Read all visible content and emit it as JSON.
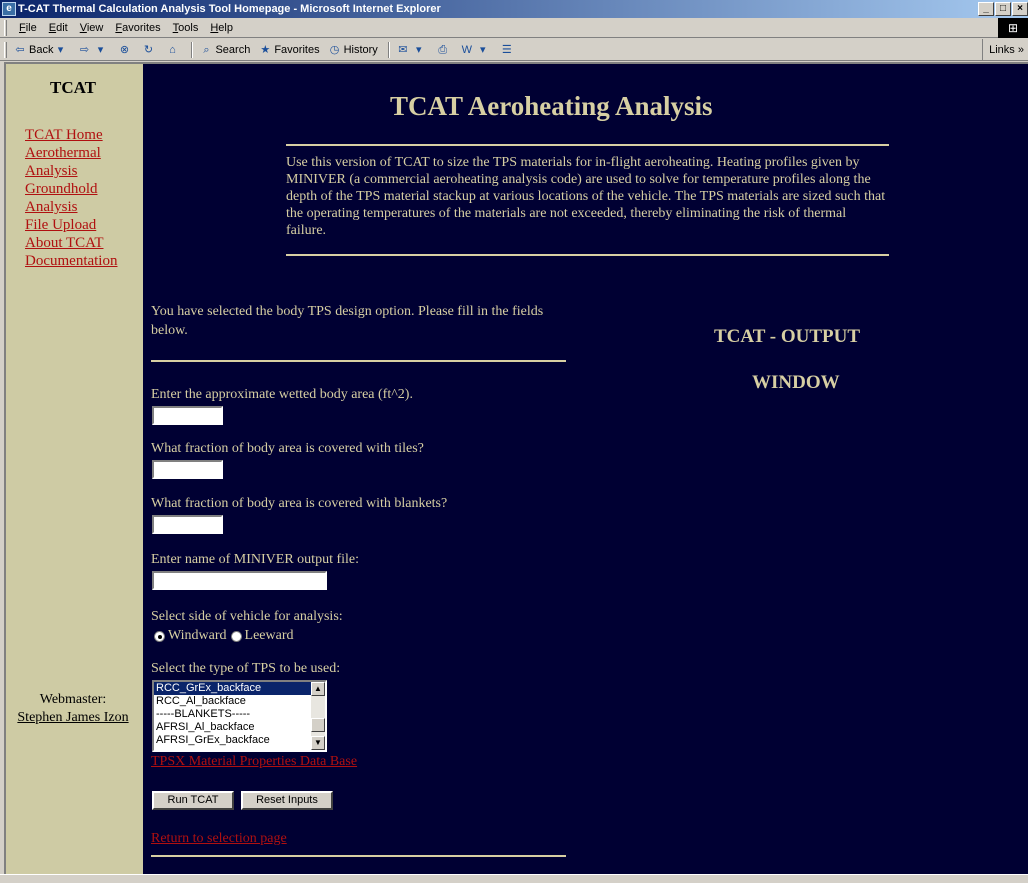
{
  "window": {
    "title": "T-CAT Thermal Calculation Analysis Tool Homepage - Microsoft Internet Explorer",
    "minimize_glyph": "_",
    "maximize_glyph": "□",
    "close_glyph": "×"
  },
  "menu": [
    "File",
    "Edit",
    "View",
    "Favorites",
    "Tools",
    "Help"
  ],
  "toolbar": {
    "back": "Back",
    "search": "Search",
    "favorites": "Favorites",
    "history": "History",
    "links": "Links"
  },
  "sidebar": {
    "title": "TCAT",
    "links": [
      "TCAT Home",
      "Aerothermal Analysis",
      "Groundhold Analysis",
      "File Upload",
      "About TCAT",
      "Documentation"
    ],
    "webmaster_label": "Webmaster:",
    "webmaster_name": "Stephen James Izon"
  },
  "main": {
    "title": "TCAT Aeroheating Analysis",
    "description": "Use this version of TCAT to size the TPS materials for in-flight aeroheating. Heating profiles given by MINIVER (a commercial aeroheating analysis code) are used to solve for temperature profiles along the depth of the TPS material stackup at various locations of the vehicle. The TPS materials are sized such that the operating temperatures of the materials are not exceeded, thereby eliminating the risk of thermal failure."
  },
  "form": {
    "intro": "You have selected the body TPS design option. Please fill in the fields below.",
    "q_area": "Enter the approximate wetted body area (ft^2).",
    "q_tiles": "What fraction of body area is covered with tiles?",
    "q_blankets": "What fraction of body area is covered with blankets?",
    "q_file": "Enter name of MINIVER output file:",
    "area_value": "",
    "tiles_value": "",
    "blankets_value": "",
    "file_value": "",
    "q_side": "Select side of vehicle for analysis:",
    "side_options": [
      "Windward",
      "Leeward"
    ],
    "side_selected": "Windward",
    "q_tps": "Select the type of TPS to be used:",
    "tps_options": [
      "RCC_GrEx_backface",
      "RCC_Al_backface",
      "-----BLANKETS-----",
      "AFRSI_Al_backface",
      "AFRSI_GrEx_backface"
    ],
    "tps_selected": "RCC_GrEx_backface",
    "tpsx_link": "TPSX Material Properties Data Base",
    "run_button": "Run TCAT",
    "reset_button": "Reset Inputs",
    "return_link": "Return to selection page"
  },
  "output": {
    "line1": "TCAT - OUTPUT",
    "line2": "WINDOW"
  }
}
